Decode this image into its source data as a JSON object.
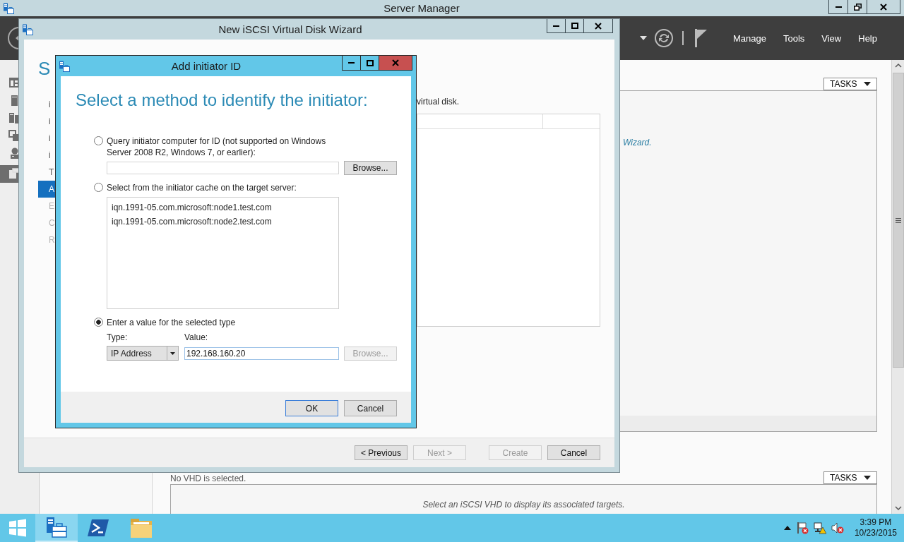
{
  "server_manager": {
    "title": "Server Manager",
    "menu": [
      "Manage",
      "Tools",
      "View",
      "Help"
    ],
    "sidebar": [
      {
        "selected": false
      },
      {
        "selected": false
      },
      {
        "selected": false
      },
      {
        "selected": false
      },
      {
        "selected": false
      },
      {
        "selected": true
      }
    ],
    "upper_panel": {
      "tasks": "TASKS",
      "hint": "Wizard."
    },
    "lower_panel": {
      "status": "No VHD is selected.",
      "tasks": "TASKS",
      "hint": "Select an iSCSI VHD to display its associated targets."
    }
  },
  "wizard": {
    "title": "New iSCSI Virtual Disk Wizard",
    "heading": "S",
    "steps": [
      {
        "label": "i",
        "selected": false,
        "disabled": false
      },
      {
        "label": "i",
        "selected": false,
        "disabled": false
      },
      {
        "label": "i",
        "selected": false,
        "disabled": false
      },
      {
        "label": "i",
        "selected": false,
        "disabled": false
      },
      {
        "label": "T",
        "selected": false,
        "disabled": false
      },
      {
        "label": "A",
        "selected": true,
        "disabled": false
      },
      {
        "label": "E",
        "selected": false,
        "disabled": true
      },
      {
        "label": "C",
        "selected": false,
        "disabled": true
      },
      {
        "label": "R",
        "selected": false,
        "disabled": true
      }
    ],
    "intro": "virtual disk.",
    "buttons": [
      {
        "label": "< Previous",
        "disabled": false
      },
      {
        "label": "Next >",
        "disabled": true
      },
      {
        "label": "Create",
        "disabled": true
      },
      {
        "label": "Cancel",
        "disabled": false
      }
    ]
  },
  "dialog": {
    "title": "Add initiator ID",
    "heading": "Select a method to identify the initiator:",
    "options": [
      {
        "kind": "query",
        "label": "Query initiator computer for ID (not supported on Windows Server 2008 R2, Windows 7, or earlier):",
        "selected": false,
        "browse": {
          "label": "Browse...",
          "disabled": false
        }
      },
      {
        "kind": "cache",
        "label": "Select from the initiator cache on the target server:",
        "selected": false,
        "items": [
          "iqn.1991-05.com.microsoft:node1.test.com",
          "iqn.1991-05.com.microsoft:node2.test.com"
        ]
      },
      {
        "kind": "value",
        "label": "Enter a value for the selected type",
        "selected": true,
        "type_label": "Type:",
        "type_value": "IP Address",
        "value_label": "Value:",
        "value": "192.168.160.20",
        "browse": {
          "label": "Browse...",
          "disabled": true
        }
      }
    ],
    "buttons": [
      {
        "label": "OK",
        "default": true
      },
      {
        "label": "Cancel",
        "default": false
      }
    ]
  },
  "taskbar": {
    "apps": [
      {
        "kind": "server_manager",
        "selected": true
      },
      {
        "kind": "powershell",
        "selected": false
      },
      {
        "kind": "explorer",
        "selected": false
      }
    ],
    "clock": {
      "time": "3:39 PM",
      "date": "10/23/2015"
    }
  }
}
